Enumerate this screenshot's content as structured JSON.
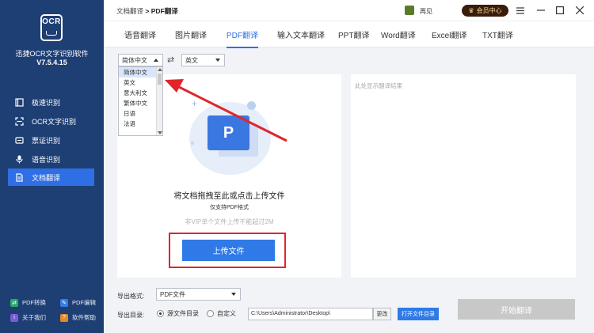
{
  "app": {
    "logo_text": "OCR",
    "name": "迅捷OCR文字识别软件",
    "version": "V7.5.4.15"
  },
  "nav": [
    {
      "label": "极速识别"
    },
    {
      "label": "OCR文字识别"
    },
    {
      "label": "票证识别"
    },
    {
      "label": "语音识别"
    },
    {
      "label": "文档翻译"
    }
  ],
  "footer": [
    {
      "label": "PDF转换"
    },
    {
      "label": "PDF编辑"
    },
    {
      "label": "关于我们"
    },
    {
      "label": "软件帮助"
    }
  ],
  "titlebar": {
    "crumb_parent": "文档翻译",
    "crumb_sep": ">",
    "crumb_current": "PDF翻译",
    "user_name": "再见",
    "vip_label": "会员中心"
  },
  "tabs": [
    {
      "label": "语音翻译"
    },
    {
      "label": "图片翻译"
    },
    {
      "label": "PDF翻译"
    },
    {
      "label": "输入文本翻译"
    },
    {
      "label": "PPT翻译"
    },
    {
      "label": "Word翻译"
    },
    {
      "label": "Excel翻译"
    },
    {
      "label": "TXT翻译"
    }
  ],
  "source_lang": {
    "selected": "简体中文",
    "options": [
      "简体中文",
      "英文",
      "意大利文",
      "繁体中文",
      "日语",
      "法语"
    ]
  },
  "target_lang": {
    "selected": "英文"
  },
  "swap_icon": "⇄",
  "result_placeholder": "此处显示翻译结果",
  "upload": {
    "doc_letter": "P",
    "plus": "+",
    "drop_text": "将文档拖拽至此或点击上传文件",
    "support_text": "仅支持PDF格式",
    "limit_text": "非VIP单个文件上传不能超过2M",
    "button_label": "上传文件"
  },
  "bottom": {
    "export_format_label": "导出格式:",
    "export_format_value": "PDF文件",
    "export_dir_label": "导出目录:",
    "radio_source": "源文件目录",
    "radio_custom": "自定义",
    "path_value": "C:\\Users\\Administrator\\Desktop\\",
    "change_label": "更改",
    "open_folder_label": "打开文件目录",
    "start_label": "开始翻译"
  },
  "colors": {
    "sidebar": "#1e3f74",
    "accent": "#2f6fe6",
    "highlight_red": "#e0262b"
  }
}
